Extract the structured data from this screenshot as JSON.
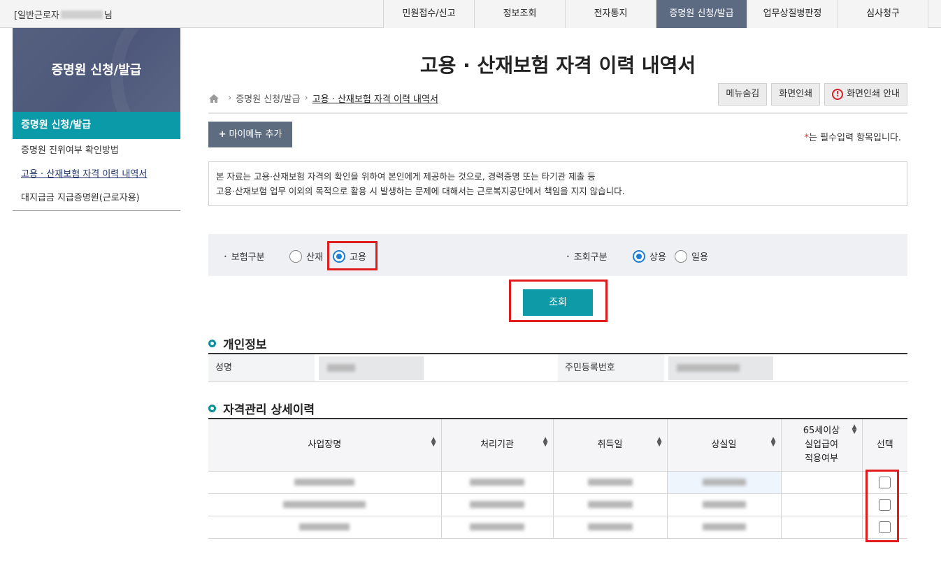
{
  "header": {
    "user_prefix": "[일반근로자",
    "user_suffix": "님",
    "nav": [
      {
        "label": "민원접수/신고",
        "active": false
      },
      {
        "label": "정보조회",
        "active": false
      },
      {
        "label": "전자통지",
        "active": false
      },
      {
        "label": "증명원 신청/발급",
        "active": true
      },
      {
        "label": "업무상질병판정",
        "active": false
      },
      {
        "label": "심사청구",
        "active": false
      }
    ]
  },
  "sidebar": {
    "title": "증명원 신청/발급",
    "active_item": "증명원 신청/발급",
    "items": [
      {
        "label": "증명원 진위여부 확인방법",
        "current": false
      },
      {
        "label": "고용 · 산재보험 자격 이력 내역서",
        "current": true
      },
      {
        "label": "대지급금 지급증명원(근로자용)",
        "current": false
      }
    ]
  },
  "main": {
    "title": "고용 · 산재보험 자격 이력 내역서",
    "breadcrumb": [
      "증명원 신청/발급",
      "고용 · 산재보험 자격 이력 내역서"
    ],
    "tools": {
      "hide_menu": "메뉴숨김",
      "print": "화면인쇄",
      "print_guide": "화면인쇄 안내"
    },
    "add_mymenu": "마이메뉴 추가",
    "required_note_star": "*",
    "required_note": "는 필수입력 항목입니다.",
    "notice_line1": "본 자료는 고용·산재보험 자격의 확인을 위하여 본인에게 제공하는 것으로, 경력증명 또는 타기관 제출 등",
    "notice_line2": "고용·산재보험 업무 이외의 목적으로 활용 시 발생하는 문제에 대해서는 근로복지공단에서 책임을 지지 않습니다.",
    "filter": {
      "insurance_label": "보험구분",
      "insurance_options": [
        {
          "label": "산재",
          "checked": false
        },
        {
          "label": "고용",
          "checked": true
        }
      ],
      "query_label": "조회구분",
      "query_options": [
        {
          "label": "상용",
          "checked": true
        },
        {
          "label": "일용",
          "checked": false
        }
      ]
    },
    "search_button": "조회",
    "personal": {
      "section_title": "개인정보",
      "name_label": "성명",
      "rrn_label": "주민등록번호"
    },
    "history": {
      "section_title": "자격관리 상세이력",
      "columns": [
        "사업장명",
        "처리기관",
        "취득일",
        "상실일",
        "65세이상\n실업급여\n적용여부",
        "선택"
      ],
      "rows": [
        {
          "checked": false
        },
        {
          "checked": false
        },
        {
          "checked": false
        }
      ]
    }
  },
  "colors": {
    "accent_teal": "#0f9aa8",
    "nav_active": "#5c6a82",
    "highlight_red": "#e01c1c",
    "radio_blue": "#1b7fd6"
  }
}
